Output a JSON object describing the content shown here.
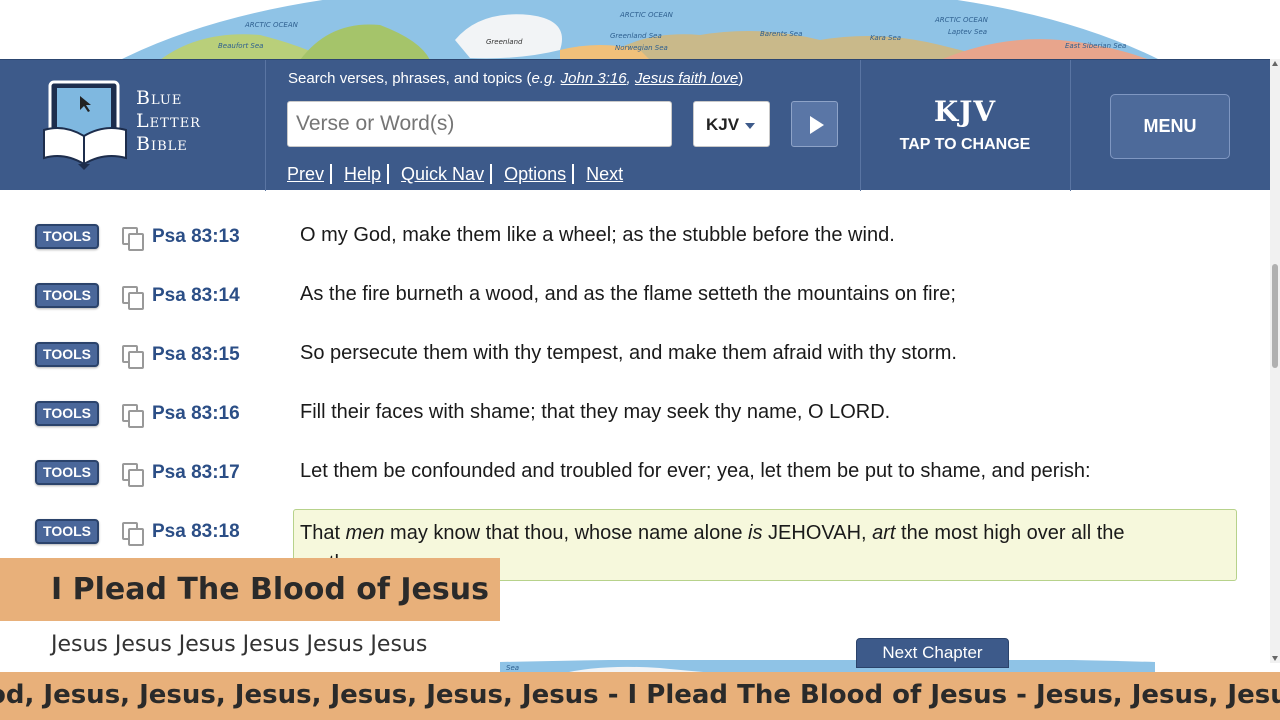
{
  "map_labels": [
    "ARCTIC OCEAN",
    "ARCTIC OCEAN",
    "ARCTIC OCEAN",
    "Greenland",
    "Beaufort Sea",
    "Greenland Sea",
    "Barents Sea",
    "Kara Sea",
    "Norwegian Sea",
    "Laptev Sea",
    "East Siberian Sea",
    "Sea"
  ],
  "logo": {
    "line1": "Blue",
    "line2": "Letter",
    "line3": "Bible"
  },
  "search": {
    "hint_prefix": "Search verses, phrases, and topics (",
    "hint_eg": "e.g.",
    "hint_link1": "John 3:16",
    "hint_link2": "Jesus faith love",
    "hint_suffix": ")",
    "placeholder": "Verse or Word(s)",
    "version": "KJV"
  },
  "nav": {
    "prev": "Prev",
    "help": "Help",
    "quick_nav": "Quick Nav",
    "options": "Options",
    "next": "Next"
  },
  "version_panel": {
    "name": "KJV",
    "action": "TAP TO CHANGE"
  },
  "menu_label": "MENU",
  "tools_label": "TOOLS",
  "verses": [
    {
      "ref": "Psa 83:13",
      "text": "O my God, make them like a wheel; as the stubble before the wind."
    },
    {
      "ref": "Psa 83:14",
      "text": "As the fire burneth a wood, and as the flame setteth the mountains on fire;"
    },
    {
      "ref": "Psa 83:15",
      "text": "So persecute them with thy tempest, and make them afraid with thy storm."
    },
    {
      "ref": "Psa 83:16",
      "text": "Fill their faces with shame; that they may seek thy name, O LORD."
    },
    {
      "ref": "Psa 83:17",
      "text": "Let them be confounded and troubled for ever; yea, let them be put to shame, and perish:"
    }
  ],
  "highlighted_verse": {
    "ref": "Psa 83:18",
    "t1": "That ",
    "i1": "men",
    "t2": " may know that thou, whose name alone ",
    "i2": "is",
    "t3": " JEHOVAH, ",
    "i3": "art",
    "t4": " the most high over all the earth."
  },
  "overlay": {
    "title": "I Plead The Blood of Jesus",
    "subline": "Jesus Jesus Jesus Jesus Jesus Jesus"
  },
  "next_chapter_label": "Next Chapter",
  "ticker": "od, Jesus, Jesus, Jesus, Jesus, Jesus, Jesus - I Plead The Blood of Jesus - Jesus, Jesus, Jesus - You Are"
}
